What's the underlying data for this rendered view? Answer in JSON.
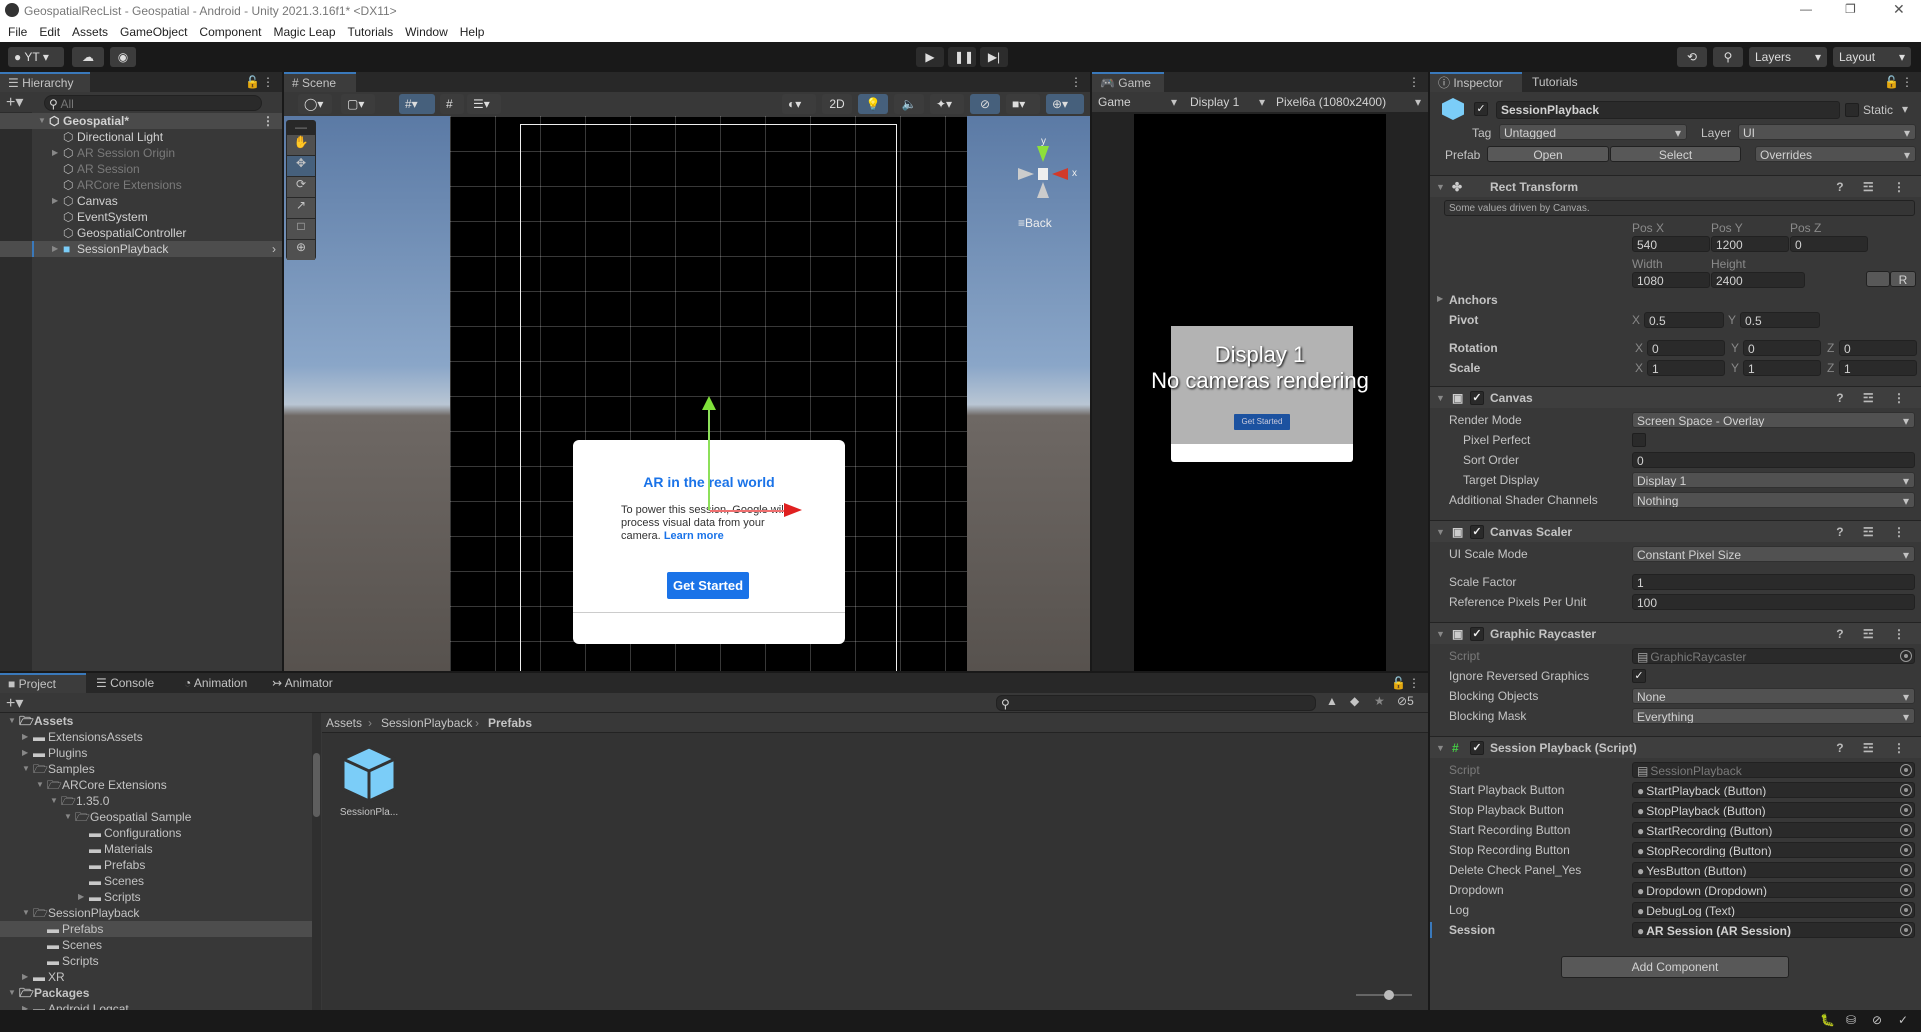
{
  "window": {
    "title": "GeospatialRecList - Geospatial - Android - Unity 2021.3.16f1* <DX11>"
  },
  "menu": [
    "File",
    "Edit",
    "Assets",
    "GameObject",
    "Component",
    "Magic Leap",
    "Tutorials",
    "Window",
    "Help"
  ],
  "toolbar": {
    "account": "YT",
    "layers": "Layers",
    "layout": "Layout"
  },
  "hierarchy": {
    "tab": "Hierarchy",
    "search_placeholder": "All",
    "items": [
      {
        "label": "Geospatial*",
        "depth": 0,
        "arrow": "expanded",
        "scene": true
      },
      {
        "label": "Directional Light",
        "depth": 1,
        "arrow": "none",
        "active": true
      },
      {
        "label": "AR Session Origin",
        "depth": 1,
        "arrow": "collapsed",
        "active": false
      },
      {
        "label": "AR Session",
        "depth": 1,
        "arrow": "none",
        "active": false
      },
      {
        "label": "ARCore Extensions",
        "depth": 1,
        "arrow": "none",
        "active": false
      },
      {
        "label": "Canvas",
        "depth": 1,
        "arrow": "collapsed",
        "active": true
      },
      {
        "label": "EventSystem",
        "depth": 1,
        "arrow": "none",
        "active": true
      },
      {
        "label": "GeospatialController",
        "depth": 1,
        "arrow": "none",
        "active": true
      },
      {
        "label": "SessionPlayback",
        "depth": 1,
        "arrow": "collapsed",
        "active": true,
        "selected": true,
        "prefab": true
      }
    ]
  },
  "scene": {
    "tab": "Scene",
    "mode_2d": "2D",
    "gizmo_y": "y",
    "gizmo_x": "x",
    "back_label": "Back",
    "dialog": {
      "title": "AR in the real world",
      "body": "To power this session, Google will process visual data from your camera.",
      "link": "Learn more",
      "button": "Get Started"
    }
  },
  "game": {
    "tab": "Game",
    "view": "Game",
    "display": "Display 1",
    "resolution": "Pixel6a (1080x2400)",
    "overlay_line1": "Display 1",
    "overlay_line2": "No cameras rendering",
    "popup_button": "Get Started"
  },
  "inspector": {
    "tabs": [
      "Inspector",
      "Tutorials"
    ],
    "object_name": "SessionPlayback",
    "static_label": "Static",
    "tag_label": "Tag",
    "tag": "Untagged",
    "layer_label": "Layer",
    "layer": "UI",
    "prefab_label": "Prefab",
    "prefab_open": "Open",
    "prefab_select": "Select",
    "prefab_overrides": "Overrides",
    "rect": {
      "title": "Rect Transform",
      "note": "Some values driven by Canvas.",
      "pos_x_label": "Pos X",
      "pos_y_label": "Pos Y",
      "pos_z_label": "Pos Z",
      "pos_x": "540",
      "pos_y": "1200",
      "pos_z": "0",
      "width_label": "Width",
      "height_label": "Height",
      "width": "1080",
      "height": "2400",
      "r_button": "R",
      "anchors": "Anchors",
      "pivot": "Pivot",
      "pivot_x": "0.5",
      "pivot_y": "0.5",
      "rotation": "Rotation",
      "rot": [
        "0",
        "0",
        "0"
      ],
      "scale": "Scale",
      "scl": [
        "1",
        "1",
        "1"
      ],
      "axes": [
        "X",
        "Y",
        "Z"
      ]
    },
    "components": [
      {
        "title": "Canvas",
        "icon": "canvas-icon",
        "rows": [
          {
            "label": "Render Mode",
            "type": "dropdown",
            "value": "Screen Space - Overlay"
          },
          {
            "label": "Pixel Perfect",
            "type": "check",
            "checked": false,
            "indent": true
          },
          {
            "label": "Sort Order",
            "type": "text",
            "value": "0",
            "indent": true
          },
          {
            "label": "Target Display",
            "type": "dropdown",
            "value": "Display 1",
            "indent": true
          },
          {
            "label": "Additional Shader Channels",
            "type": "dropdown",
            "value": "Nothing"
          }
        ]
      },
      {
        "title": "Canvas Scaler",
        "icon": "canvas-scaler-icon",
        "rows": [
          {
            "label": "UI Scale Mode",
            "type": "dropdown",
            "value": "Constant Pixel Size"
          },
          {
            "label": "",
            "type": "gap"
          },
          {
            "label": "Scale Factor",
            "type": "text",
            "value": "1"
          },
          {
            "label": "Reference Pixels Per Unit",
            "type": "text",
            "value": "100"
          }
        ]
      },
      {
        "title": "Graphic Raycaster",
        "icon": "graphic-raycaster-icon",
        "rows": [
          {
            "label": "Script",
            "type": "object",
            "value": "GraphicRaycaster",
            "disabled": true
          },
          {
            "label": "Ignore Reversed Graphics",
            "type": "check",
            "checked": true
          },
          {
            "label": "Blocking Objects",
            "type": "dropdown",
            "value": "None"
          },
          {
            "label": "Blocking Mask",
            "type": "dropdown",
            "value": "Everything"
          }
        ]
      },
      {
        "title": "Session Playback (Script)",
        "icon": "script-icon",
        "rows": [
          {
            "label": "Script",
            "type": "object",
            "value": "SessionPlayback",
            "disabled": true
          },
          {
            "label": "Start Playback Button",
            "type": "object",
            "value": "StartPlayback (Button)"
          },
          {
            "label": "Stop Playback Button",
            "type": "object",
            "value": "StopPlayback (Button)"
          },
          {
            "label": "Start Recording Button",
            "type": "object",
            "value": "StartRecording (Button)"
          },
          {
            "label": "Stop Recording Button",
            "type": "object",
            "value": "StopRecording (Button)"
          },
          {
            "label": "Delete Check Panel_Yes",
            "type": "object",
            "value": "YesButton (Button)"
          },
          {
            "label": "Dropdown",
            "type": "object",
            "value": "Dropdown (Dropdown)"
          },
          {
            "label": "Log",
            "type": "object",
            "value": "DebugLog (Text)"
          },
          {
            "label": "Session",
            "type": "object",
            "value": "AR Session (AR Session)",
            "bold": true
          }
        ]
      }
    ],
    "add_component": "Add Component"
  },
  "project": {
    "tabs": [
      "Project",
      "Console",
      "Animation",
      "Animator"
    ],
    "hidden_count": "5",
    "tree": [
      {
        "label": "Assets",
        "depth": 0,
        "arrow": "expanded",
        "bold": true,
        "open": true
      },
      {
        "label": "ExtensionsAssets",
        "depth": 1,
        "arrow": "collapsed"
      },
      {
        "label": "Plugins",
        "depth": 1,
        "arrow": "collapsed"
      },
      {
        "label": "Samples",
        "depth": 1,
        "arrow": "expanded",
        "open": true
      },
      {
        "label": "ARCore Extensions",
        "depth": 2,
        "arrow": "expanded",
        "open": true
      },
      {
        "label": "1.35.0",
        "depth": 3,
        "arrow": "expanded",
        "open": true
      },
      {
        "label": "Geospatial Sample",
        "depth": 4,
        "arrow": "expanded",
        "open": true
      },
      {
        "label": "Configurations",
        "depth": 5,
        "arrow": "none"
      },
      {
        "label": "Materials",
        "depth": 5,
        "arrow": "none"
      },
      {
        "label": "Prefabs",
        "depth": 5,
        "arrow": "none"
      },
      {
        "label": "Scenes",
        "depth": 5,
        "arrow": "none"
      },
      {
        "label": "Scripts",
        "depth": 5,
        "arrow": "collapsed"
      },
      {
        "label": "SessionPlayback",
        "depth": 1,
        "arrow": "expanded",
        "open": true
      },
      {
        "label": "Prefabs",
        "depth": 2,
        "arrow": "none",
        "selected": true
      },
      {
        "label": "Scenes",
        "depth": 2,
        "arrow": "none"
      },
      {
        "label": "Scripts",
        "depth": 2,
        "arrow": "none"
      },
      {
        "label": "XR",
        "depth": 1,
        "arrow": "collapsed"
      },
      {
        "label": "Packages",
        "depth": 0,
        "arrow": "expanded",
        "bold": true,
        "open": true
      },
      {
        "label": "Android Logcat",
        "depth": 1,
        "arrow": "collapsed"
      }
    ],
    "breadcrumb": [
      "Assets",
      "SessionPlayback",
      "Prefabs"
    ],
    "assets": [
      {
        "label": "SessionPla..."
      }
    ]
  },
  "colors": {
    "accent": "#3a79bb",
    "prefab": "#7bcdf8",
    "dialog_blue": "#1a73e8"
  }
}
